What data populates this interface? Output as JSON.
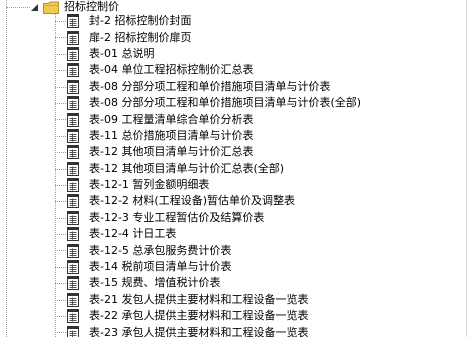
{
  "tree": {
    "folder": {
      "label": "招标控制价",
      "icon": "folder-icon",
      "toggle_icon": "expanded-triangle-icon",
      "folder_color": "#f2c94c"
    },
    "doc_icon": "table-document-icon",
    "items": [
      {
        "label": "封-2 招标控制价封面"
      },
      {
        "label": "扉-2 招标控制价扉页"
      },
      {
        "label": "表-01 总说明"
      },
      {
        "label": "表-04 单位工程招标控制价汇总表"
      },
      {
        "label": "表-08 分部分项工程和单价措施项目清单与计价表"
      },
      {
        "label": "表-08 分部分项工程和单价措施项目清单与计价表(全部)"
      },
      {
        "label": "表-09 工程量清单综合单价分析表"
      },
      {
        "label": "表-11 总价措施项目清单与计价表"
      },
      {
        "label": "表-12 其他项目清单与计价汇总表"
      },
      {
        "label": "表-12 其他项目清单与计价汇总表(全部)"
      },
      {
        "label": "表-12-1 暂列金额明细表"
      },
      {
        "label": "表-12-2 材料(工程设备)暂估单价及调整表"
      },
      {
        "label": "表-12-3 专业工程暂估价及结算价表"
      },
      {
        "label": "表-12-4 计日工表"
      },
      {
        "label": "表-12-5 总承包服务费计价表"
      },
      {
        "label": "表-14 税前项目清单与计价表"
      },
      {
        "label": "表-15 规费、增值税计价表"
      },
      {
        "label": "表-21 发包人提供主要材料和工程设备一览表"
      },
      {
        "label": "表-22 承包人提供主要材料和工程设备一览表"
      },
      {
        "label": "表-23 承包人提供主要材料和工程设备一览表"
      }
    ]
  }
}
